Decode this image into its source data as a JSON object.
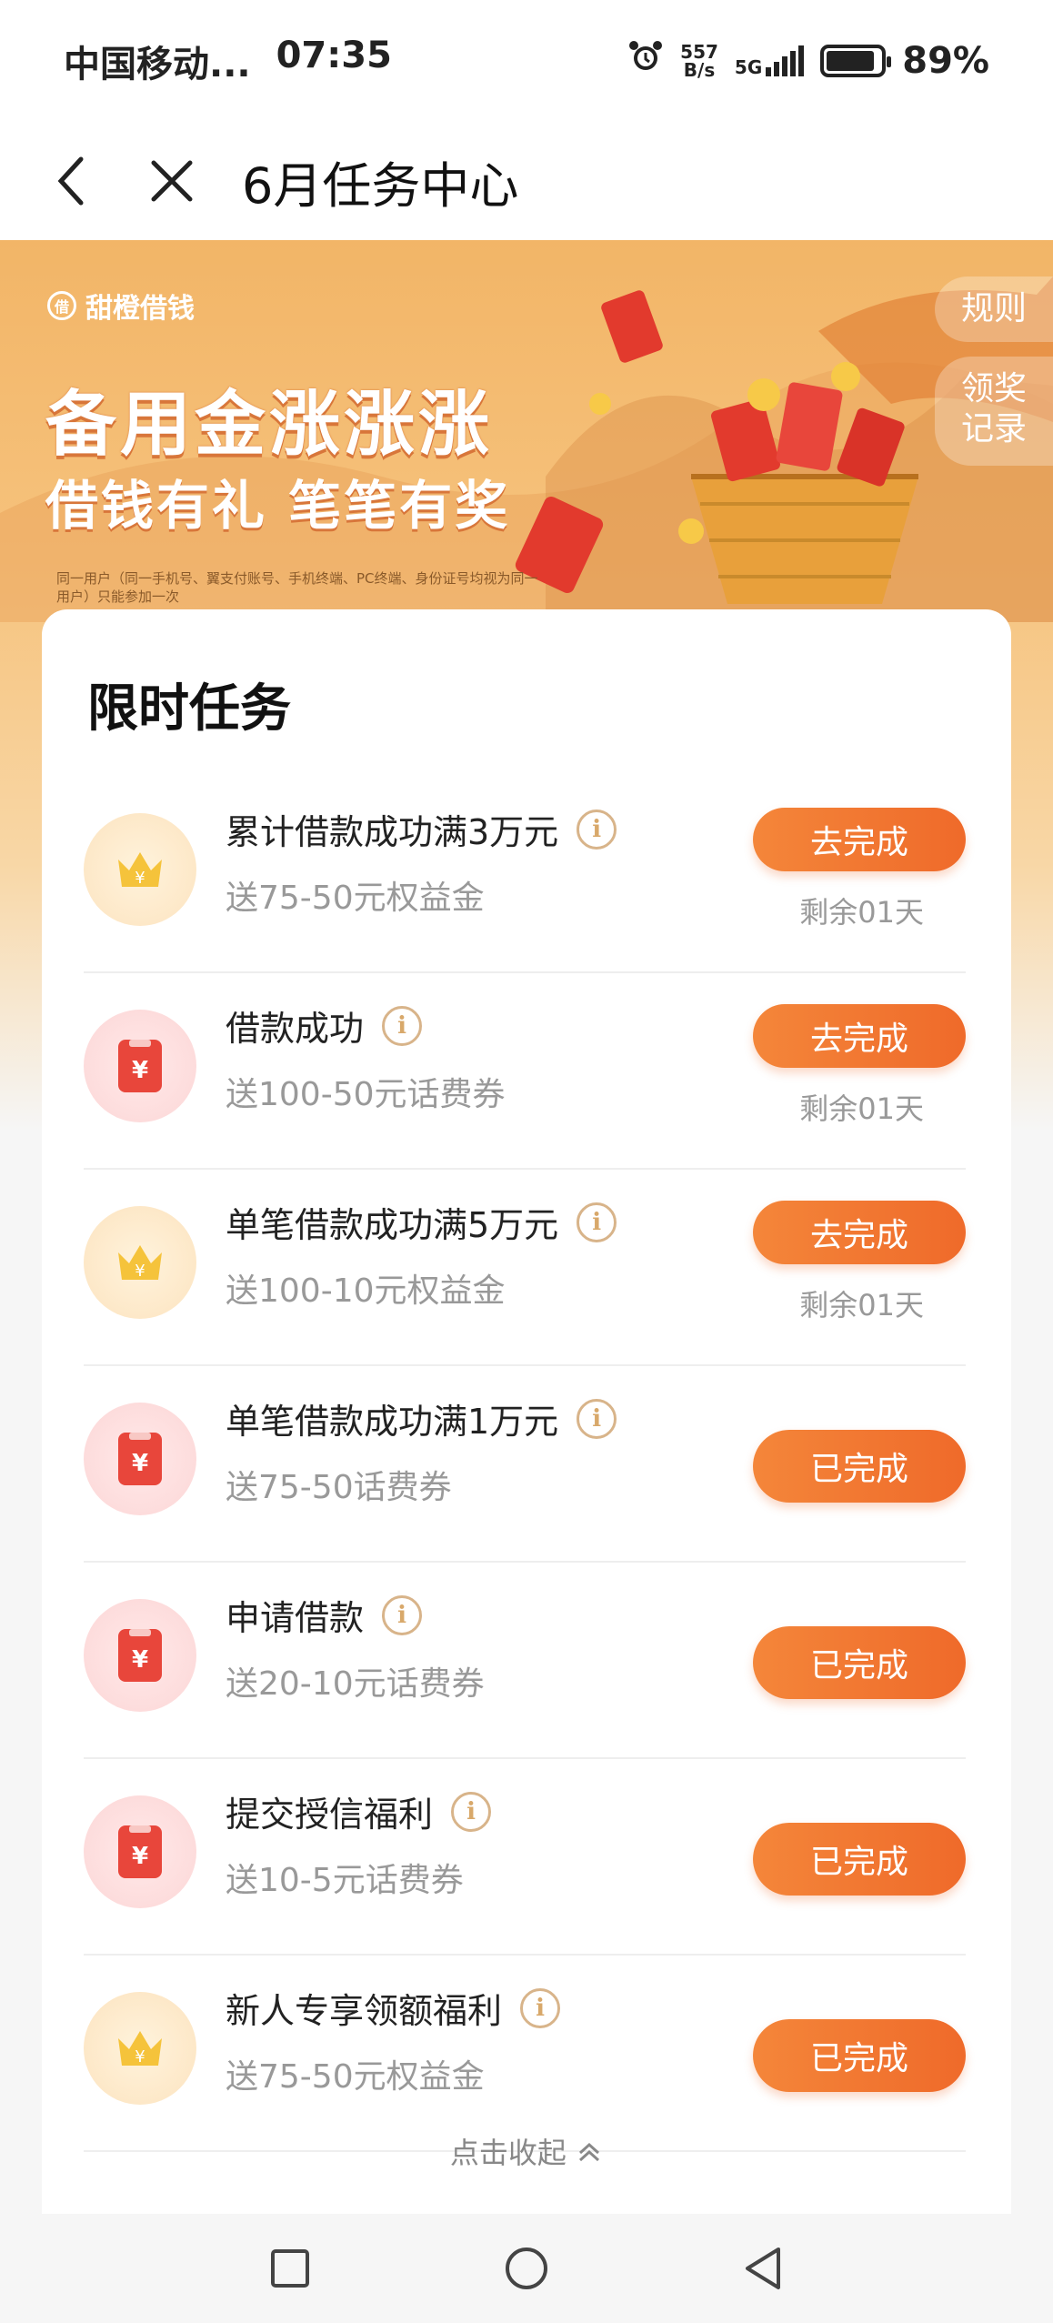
{
  "status_bar": {
    "carrier": "中国移动...",
    "time": "07:35",
    "net_speed_top": "557",
    "net_speed_bottom": "B/s",
    "network_type": "5G",
    "battery_percent": "89%",
    "battery_level": 0.89
  },
  "nav": {
    "title": "6月任务中心",
    "back_icon": "chevron-left-icon",
    "close_icon": "close-icon"
  },
  "banner": {
    "brand": "甜橙借钱",
    "headline1": "备用金涨涨涨",
    "headline2": "借钱有礼 笔笔有奖",
    "disclaimer": "同一用户（同一手机号、翼支付账号、手机终端、PC终端、身份证号均视为同一用户）只能参加一次",
    "rules_label": "规则",
    "records_label_line1": "领奖",
    "records_label_line2": "记录"
  },
  "tasks_section": {
    "title": "限时任务",
    "items": [
      {
        "name": "累计借款成功满3万元",
        "reward": "送75-50元权益金",
        "icon": "crown-icon",
        "button": "去完成",
        "days_left": "剩余01天"
      },
      {
        "name": "借款成功",
        "reward": "送100-50元话费券",
        "icon": "red-packet-icon",
        "button": "去完成",
        "days_left": "剩余01天"
      },
      {
        "name": "单笔借款成功满5万元",
        "reward": "送100-10元权益金",
        "icon": "crown-icon",
        "button": "去完成",
        "days_left": "剩余01天"
      },
      {
        "name": "单笔借款成功满1万元",
        "reward": "送75-50话费券",
        "icon": "red-packet-icon",
        "button": "已完成"
      },
      {
        "name": "申请借款",
        "reward": "送20-10元话费券",
        "icon": "red-packet-icon",
        "button": "已完成"
      },
      {
        "name": "提交授信福利",
        "reward": "送10-5元话费券",
        "icon": "red-packet-icon",
        "button": "已完成"
      },
      {
        "name": "新人专享领额福利",
        "reward": "送75-50元权益金",
        "icon": "crown-icon",
        "button": "已完成"
      }
    ],
    "collapse_label": "点击收起"
  },
  "colors": {
    "accent": "#ef6a2a",
    "banner": "#f2b567",
    "crown": "#f5c33b",
    "packet": "#e8463b"
  },
  "system_nav": [
    "recent-apps-icon",
    "home-icon",
    "back-icon"
  ]
}
